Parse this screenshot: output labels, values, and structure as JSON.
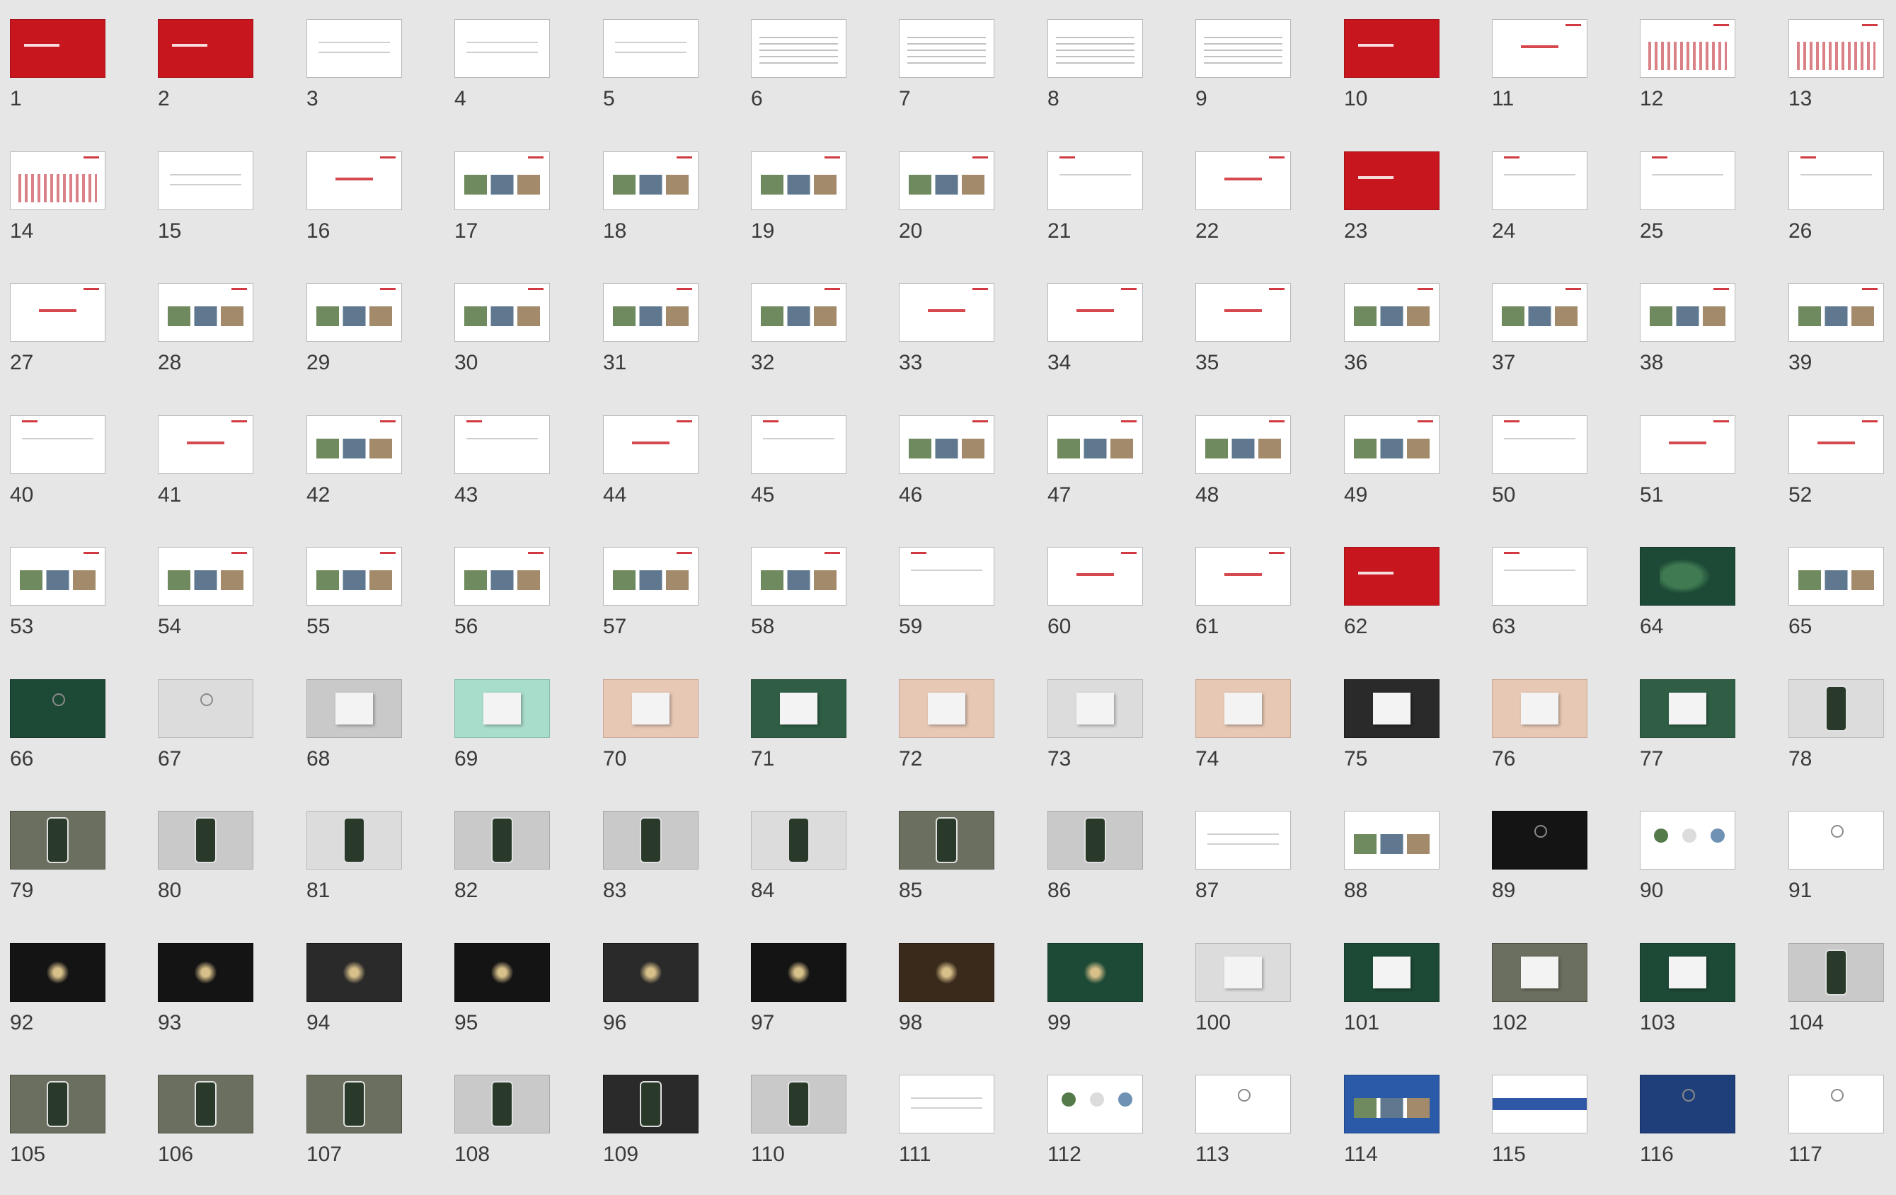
{
  "slides": [
    {
      "n": "1",
      "s": "t-red deco-whitetext"
    },
    {
      "n": "2",
      "s": "t-red deco-whitetext"
    },
    {
      "n": "3",
      "s": "deco-lines"
    },
    {
      "n": "4",
      "s": "deco-lines"
    },
    {
      "n": "5",
      "s": "deco-lines"
    },
    {
      "n": "6",
      "s": "deco-logos"
    },
    {
      "n": "7",
      "s": "deco-logos"
    },
    {
      "n": "8",
      "s": "deco-logos"
    },
    {
      "n": "9",
      "s": "deco-logos"
    },
    {
      "n": "10",
      "s": "t-red deco-whitetext"
    },
    {
      "n": "11",
      "s": "deco-title deco-redbar"
    },
    {
      "n": "12",
      "s": "deco-chart deco-redbar"
    },
    {
      "n": "13",
      "s": "deco-chart deco-redbar"
    },
    {
      "n": "14",
      "s": "deco-chart deco-redbar"
    },
    {
      "n": "15",
      "s": "deco-lines"
    },
    {
      "n": "16",
      "s": "deco-title deco-redbar"
    },
    {
      "n": "17",
      "s": "deco-images deco-redbar"
    },
    {
      "n": "18",
      "s": "deco-images deco-redbar"
    },
    {
      "n": "19",
      "s": "deco-images deco-redbar"
    },
    {
      "n": "20",
      "s": "deco-images deco-redbar"
    },
    {
      "n": "21",
      "s": "deco-lines deco-redbar"
    },
    {
      "n": "22",
      "s": "deco-title deco-redbar"
    },
    {
      "n": "23",
      "s": "t-red deco-whitetext"
    },
    {
      "n": "24",
      "s": "deco-lines deco-redbar"
    },
    {
      "n": "25",
      "s": "deco-lines deco-redbar"
    },
    {
      "n": "26",
      "s": "deco-lines deco-redbar"
    },
    {
      "n": "27",
      "s": "deco-title deco-redbar"
    },
    {
      "n": "28",
      "s": "deco-images deco-redbar"
    },
    {
      "n": "29",
      "s": "deco-images deco-redbar"
    },
    {
      "n": "30",
      "s": "deco-images deco-redbar"
    },
    {
      "n": "31",
      "s": "deco-images deco-redbar"
    },
    {
      "n": "32",
      "s": "deco-images deco-redbar"
    },
    {
      "n": "33",
      "s": "deco-title deco-redbar"
    },
    {
      "n": "34",
      "s": "deco-title deco-redbar"
    },
    {
      "n": "35",
      "s": "deco-title deco-redbar"
    },
    {
      "n": "36",
      "s": "deco-images deco-redbar"
    },
    {
      "n": "37",
      "s": "deco-images deco-redbar"
    },
    {
      "n": "38",
      "s": "deco-images deco-redbar"
    },
    {
      "n": "39",
      "s": "deco-images deco-redbar"
    },
    {
      "n": "40",
      "s": "deco-lines deco-redbar"
    },
    {
      "n": "41",
      "s": "deco-title deco-redbar"
    },
    {
      "n": "42",
      "s": "deco-images deco-redbar"
    },
    {
      "n": "43",
      "s": "deco-lines deco-redbar"
    },
    {
      "n": "44",
      "s": "deco-title deco-redbar"
    },
    {
      "n": "45",
      "s": "deco-lines deco-redbar"
    },
    {
      "n": "46",
      "s": "deco-images deco-redbar"
    },
    {
      "n": "47",
      "s": "deco-images deco-redbar"
    },
    {
      "n": "48",
      "s": "deco-images deco-redbar"
    },
    {
      "n": "49",
      "s": "deco-images deco-redbar"
    },
    {
      "n": "50",
      "s": "deco-lines deco-redbar"
    },
    {
      "n": "51",
      "s": "deco-title deco-redbar"
    },
    {
      "n": "52",
      "s": "deco-title deco-redbar"
    },
    {
      "n": "53",
      "s": "deco-images deco-redbar"
    },
    {
      "n": "54",
      "s": "deco-images deco-redbar"
    },
    {
      "n": "55",
      "s": "deco-images deco-redbar"
    },
    {
      "n": "56",
      "s": "deco-images deco-redbar"
    },
    {
      "n": "57",
      "s": "deco-images deco-redbar"
    },
    {
      "n": "58",
      "s": "deco-images deco-redbar"
    },
    {
      "n": "59",
      "s": "deco-lines deco-redbar"
    },
    {
      "n": "60",
      "s": "deco-title deco-redbar"
    },
    {
      "n": "61",
      "s": "deco-title deco-redbar"
    },
    {
      "n": "62",
      "s": "t-red deco-whitetext"
    },
    {
      "n": "63",
      "s": "deco-lines deco-redbar"
    },
    {
      "n": "64",
      "s": "t-dgreen deco-leaf"
    },
    {
      "n": "65",
      "s": "deco-images"
    },
    {
      "n": "66",
      "s": "t-dgreen deco-emblem"
    },
    {
      "n": "67",
      "s": "t-lgray deco-emblem"
    },
    {
      "n": "68",
      "s": "t-gray deco-card"
    },
    {
      "n": "69",
      "s": "t-teal deco-card"
    },
    {
      "n": "70",
      "s": "t-peach deco-card"
    },
    {
      "n": "71",
      "s": "t-green deco-card"
    },
    {
      "n": "72",
      "s": "t-peach deco-card"
    },
    {
      "n": "73",
      "s": "t-lgray deco-card"
    },
    {
      "n": "74",
      "s": "t-peach deco-card"
    },
    {
      "n": "75",
      "s": "t-dark deco-card"
    },
    {
      "n": "76",
      "s": "t-peach deco-card"
    },
    {
      "n": "77",
      "s": "t-green deco-card"
    },
    {
      "n": "78",
      "s": "t-lgray deco-phone"
    },
    {
      "n": "79",
      "s": "t-photo deco-phone"
    },
    {
      "n": "80",
      "s": "t-gray deco-phone"
    },
    {
      "n": "81",
      "s": "t-lgray deco-phone"
    },
    {
      "n": "82",
      "s": "t-gray deco-phone"
    },
    {
      "n": "83",
      "s": "t-gray deco-phone"
    },
    {
      "n": "84",
      "s": "t-lgray deco-phone"
    },
    {
      "n": "85",
      "s": "t-photo deco-phone"
    },
    {
      "n": "86",
      "s": "t-gray deco-phone"
    },
    {
      "n": "87",
      "s": "deco-lines"
    },
    {
      "n": "88",
      "s": "deco-images"
    },
    {
      "n": "89",
      "s": "t-black deco-emblem"
    },
    {
      "n": "90",
      "s": "deco-circles"
    },
    {
      "n": "91",
      "s": "deco-emblem"
    },
    {
      "n": "92",
      "s": "t-black deco-glow"
    },
    {
      "n": "93",
      "s": "t-black deco-glow"
    },
    {
      "n": "94",
      "s": "t-dark deco-glow"
    },
    {
      "n": "95",
      "s": "t-black deco-glow"
    },
    {
      "n": "96",
      "s": "t-dark deco-glow"
    },
    {
      "n": "97",
      "s": "t-black deco-glow"
    },
    {
      "n": "98",
      "s": "t-brown deco-glow"
    },
    {
      "n": "99",
      "s": "t-dgreen deco-glow"
    },
    {
      "n": "100",
      "s": "t-lgray deco-card"
    },
    {
      "n": "101",
      "s": "t-dgreen deco-card"
    },
    {
      "n": "102",
      "s": "t-photo deco-card"
    },
    {
      "n": "103",
      "s": "t-dgreen deco-card"
    },
    {
      "n": "104",
      "s": "t-gray deco-phone"
    },
    {
      "n": "105",
      "s": "t-photo deco-phone"
    },
    {
      "n": "106",
      "s": "t-photo deco-phone"
    },
    {
      "n": "107",
      "s": "t-photo deco-phone"
    },
    {
      "n": "108",
      "s": "t-gray deco-phone"
    },
    {
      "n": "109",
      "s": "t-dark deco-phone"
    },
    {
      "n": "110",
      "s": "t-gray deco-phone"
    },
    {
      "n": "111",
      "s": "deco-lines"
    },
    {
      "n": "112",
      "s": "deco-circles"
    },
    {
      "n": "113",
      "s": "deco-emblem"
    },
    {
      "n": "114",
      "s": "t-blue deco-images"
    },
    {
      "n": "115",
      "s": "deco-stripe"
    },
    {
      "n": "116",
      "s": "t-navy deco-emblem"
    },
    {
      "n": "117",
      "s": "deco-emblem"
    }
  ]
}
